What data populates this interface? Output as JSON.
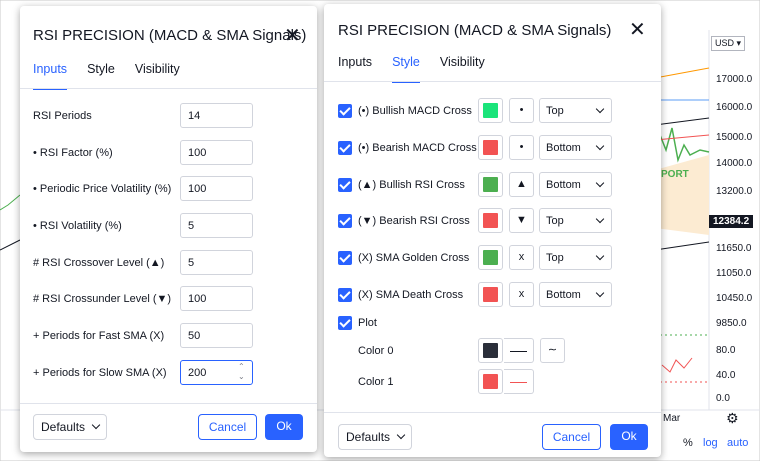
{
  "colors": {
    "accent": "#2962ff",
    "bullish": "#1ae47a",
    "bearish": "#f25353",
    "green": "#4caf50",
    "red": "#f25353",
    "dark": "#2a2e39"
  },
  "chart_bg": {
    "currency": "USD",
    "price_labels": [
      "17000.0",
      "16000.0",
      "15000.0",
      "14000.0",
      "13200.0",
      "11650.0",
      "11050.0",
      "10450.0",
      "9850.0"
    ],
    "current_price": "12384.2",
    "osc_labels": [
      "80.0",
      "40.0",
      "0.0"
    ],
    "time_label": "Mar",
    "port_label": "PORT",
    "bottom_bar": {
      "percent": "%",
      "log": "log",
      "auto": "auto"
    }
  },
  "left_dialog": {
    "title": "RSI PRECISION (MACD & SMA Signals)",
    "tabs": [
      "Inputs",
      "Style",
      "Visibility"
    ],
    "rows": [
      {
        "label": "RSI Periods",
        "value": "14"
      },
      {
        "label": "• RSI Factor (%)",
        "value": "100"
      },
      {
        "label": "• Periodic Price Volatility (%)",
        "value": "100"
      },
      {
        "label": "• RSI Volatility (%)",
        "value": "5"
      },
      {
        "label": "# RSI Crossover Level (▲)",
        "value": "5"
      },
      {
        "label": "# RSI Crossunder Level (▼)",
        "value": "100"
      },
      {
        "label": "+ Periods for Fast SMA (X)",
        "value": "50"
      },
      {
        "label": "+ Periods for Slow SMA (X)",
        "value": "200"
      }
    ],
    "defaults": "Defaults",
    "cancel": "Cancel",
    "ok": "Ok"
  },
  "right_dialog": {
    "title": "RSI PRECISION (MACD & SMA Signals)",
    "tabs": [
      "Inputs",
      "Style",
      "Visibility"
    ],
    "rows": [
      {
        "label": "(•) Bullish MACD Cross",
        "color": "#1ae47a",
        "shape": "•",
        "pos": "Top"
      },
      {
        "label": "(•) Bearish MACD Cross",
        "color": "#f25353",
        "shape": "•",
        "pos": "Bottom"
      },
      {
        "label": "(▲) Bullish RSI Cross",
        "color": "#4caf50",
        "shape": "▲",
        "pos": "Bottom"
      },
      {
        "label": "(▼) Bearish RSI Cross",
        "color": "#f25353",
        "shape": "▼",
        "pos": "Top"
      },
      {
        "label": "(X) SMA Golden Cross",
        "color": "#4caf50",
        "shape": "x",
        "pos": "Top"
      },
      {
        "label": "(X) SMA Death Cross",
        "color": "#f25353",
        "shape": "x",
        "pos": "Bottom"
      }
    ],
    "plot_label": "Plot",
    "color0_label": "Color 0",
    "color1_label": "Color 1",
    "color0": "#2a2e39",
    "color1": "#f25353",
    "defaults": "Defaults",
    "cancel": "Cancel",
    "ok": "Ok"
  }
}
